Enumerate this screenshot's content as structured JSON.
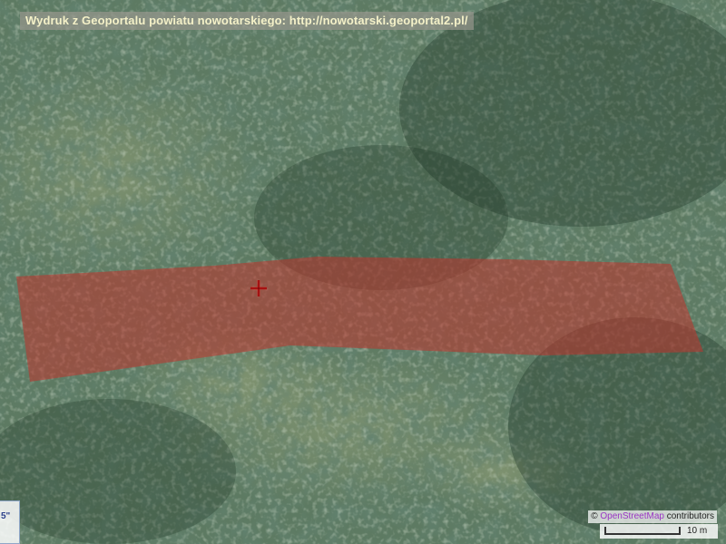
{
  "print_header": "Wydruk z Geoportalu powiatu nowotarskiego: http://nowotarski.geoportal2.pl/",
  "coordinate_display": {
    "visible_text": "5\""
  },
  "attribution": {
    "prefix": "©",
    "link_text": "OpenStreetMap",
    "suffix": "contributors"
  },
  "scale": {
    "label": "10 m"
  },
  "colors": {
    "parcel_fill": "#c0332b",
    "parcel_opacity": 0.55,
    "marker": "#d81818",
    "header_text": "#f4f1c8"
  },
  "layers": {
    "base": "aerial-orthophoto",
    "overlay": "highlighted-parcel",
    "marker": "crosshair-marker-icon"
  }
}
